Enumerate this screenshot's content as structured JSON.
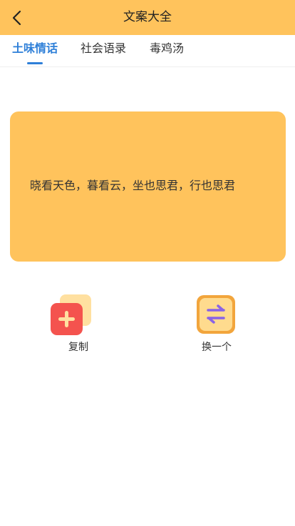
{
  "header": {
    "title": "文案大全",
    "back_icon": "chevron-left-icon"
  },
  "tabs": [
    {
      "label": "土味情话",
      "active": true
    },
    {
      "label": "社会语录",
      "active": false
    },
    {
      "label": "毒鸡汤",
      "active": false
    }
  ],
  "quote": {
    "text": "晓看天色，暮看云，坐也思君，行也思君"
  },
  "actions": {
    "copy": {
      "label": "复制",
      "icon": "copy-plus-icon"
    },
    "next": {
      "label": "换一个",
      "icon": "swap-arrows-icon"
    }
  },
  "colors": {
    "accent": "#ffc35c",
    "tab_active": "#2e7fd8",
    "copy_red": "#f4534e",
    "swap_purple": "#8a63e6"
  }
}
